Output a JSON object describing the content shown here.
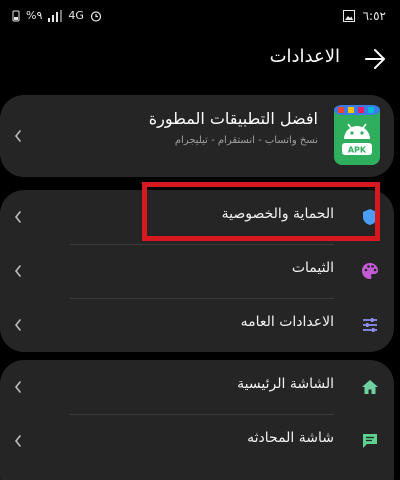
{
  "status_bar": {
    "time": "٦:٥٢",
    "battery": "%٩",
    "network": "4G"
  },
  "header": {
    "title": "الاعدادات"
  },
  "app_card": {
    "title": "افضل التطبيقات المطورة",
    "subtitle": "نسخ واتساب - انستقرام - تيليجرام",
    "icon_label": "APK"
  },
  "settings": {
    "privacy": {
      "label": "الحماية والخصوصية",
      "icon": "shield-icon"
    },
    "themes": {
      "label": "الثيمات",
      "icon": "palette-icon"
    },
    "general": {
      "label": "الاعدادات العامه",
      "icon": "sliders-icon"
    },
    "home": {
      "label": "الشاشة الرئيسية",
      "icon": "home-icon"
    },
    "chat": {
      "label": "شاشة المحادثه",
      "icon": "chat-icon"
    }
  },
  "colors": {
    "background": "#000000",
    "card": "#252525",
    "highlight": "#d8181f",
    "shield": "#4a9ef5",
    "palette": "#c45bd6",
    "sliders": "#8a8ee8",
    "home": "#6fd1a2",
    "chat": "#5fd18e"
  }
}
